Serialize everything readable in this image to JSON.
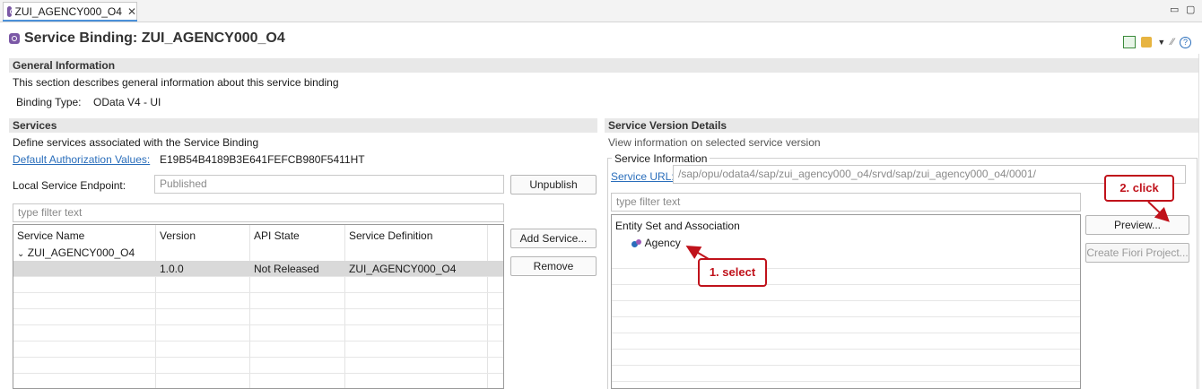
{
  "tab": {
    "label": "ZUI_AGENCY000_O4",
    "close": "✕"
  },
  "window_controls": {
    "minimize": "▭",
    "maximize": "▢"
  },
  "header": {
    "title": "Service Binding: ZUI_AGENCY000_O4"
  },
  "general": {
    "title": "General Information",
    "description": "This section describes general information about this service binding",
    "binding_type_label": "Binding Type:",
    "binding_type_value": "OData V4 - UI"
  },
  "services": {
    "title": "Services",
    "description": "Define services associated with the Service Binding",
    "auth_link": "Default Authorization Values:",
    "auth_value": "E19B54B4189B3E641FEFCB980F5411HT",
    "endpoint_label": "Local Service Endpoint:",
    "endpoint_value": "Published",
    "unpublish": "Unpublish",
    "filter_placeholder": "type filter text",
    "add_service": "Add Service...",
    "remove": "Remove",
    "columns": [
      "Service Name",
      "Version",
      "API State",
      "Service Definition"
    ],
    "group_name": "ZUI_AGENCY000_O4",
    "row": {
      "name": "",
      "version": "1.0.0",
      "api_state": "Not Released",
      "definition": "ZUI_AGENCY000_O4"
    }
  },
  "version_details": {
    "title": "Service Version Details",
    "description": "View information on selected service version",
    "group_title": "Service Information",
    "url_link": "Service URL:",
    "url_value": "/sap/opu/odata4/sap/zui_agency000_o4/srvd/sap/zui_agency000_o4/0001/",
    "filter_placeholder": "type filter text",
    "entity_header": "Entity Set and Association",
    "entity_item": "Agency",
    "preview": "Preview...",
    "create_fiori": "Create Fiori Project..."
  },
  "annotations": {
    "step1": "1. select",
    "step2": "2. click",
    "color": "#c0121b"
  }
}
